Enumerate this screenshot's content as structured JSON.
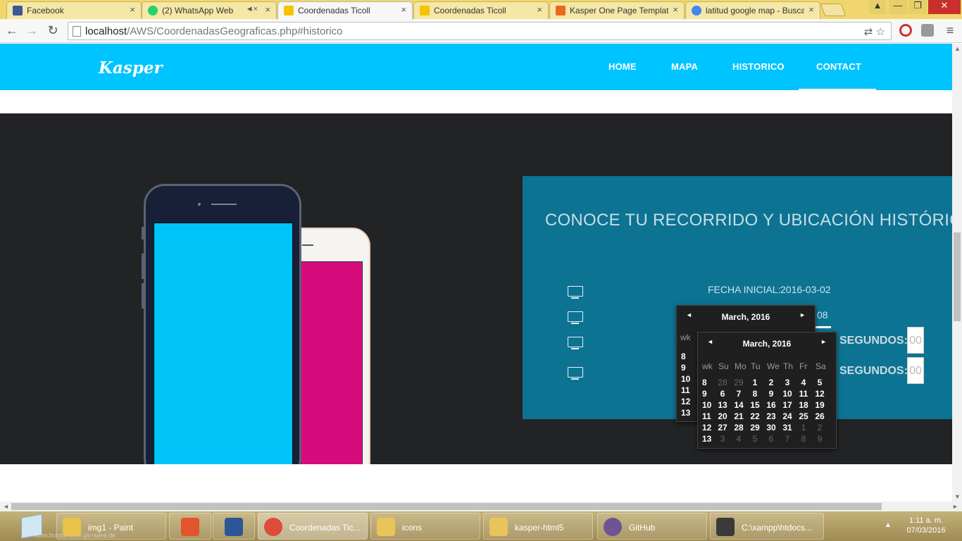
{
  "browser": {
    "tabs": [
      {
        "label": "Facebook",
        "color": "#3b5998"
      },
      {
        "label": "(2) WhatsApp Web",
        "color": "#25d366"
      },
      {
        "label": "Coordenadas Ticoll",
        "color": "#f5c400"
      },
      {
        "label": "Coordenadas Ticoll",
        "color": "#f5c400"
      },
      {
        "label": "Kasper One Page Template",
        "color": "#e86a1b"
      },
      {
        "label": "latitud google map - Busca",
        "color": "#4285f4"
      }
    ],
    "tab_close_glyph": "×",
    "url_host": "localhost",
    "url_path": "/AWS/CoordenadasGeograficas.php#historico"
  },
  "site": {
    "logo": "Kasper",
    "nav": [
      "HOME",
      "MAPA",
      "HISTORICO",
      "CONTACT"
    ],
    "accent_color": "#00c4ff"
  },
  "form": {
    "title": "CONOCE TU RECORRIDO Y UBICACIÓN HISTÓRICA",
    "fecha_inicial_label": "FECHA INICIAL:",
    "fecha_inicial_value": "2016-03-02",
    "fecha_final_partial": "08",
    "segundos_label": "SEGUNDOS:",
    "segundos_placeholder": "00"
  },
  "datepicker_back": {
    "title": "March, 2016",
    "wk_label": "wk",
    "weeks": [
      "8",
      "9",
      "10",
      "11",
      "12",
      "13"
    ]
  },
  "datepicker_front": {
    "title": "March, 2016",
    "headers": [
      "wk",
      "Su",
      "Mo",
      "Tu",
      "We",
      "Th",
      "Fr",
      "Sa"
    ],
    "rows": [
      {
        "wk": "8",
        "days": [
          {
            "d": "28",
            "m": true
          },
          {
            "d": "29",
            "m": true
          },
          {
            "d": "1"
          },
          {
            "d": "2"
          },
          {
            "d": "3"
          },
          {
            "d": "4"
          },
          {
            "d": "5"
          }
        ]
      },
      {
        "wk": "9",
        "days": [
          {
            "d": "6"
          },
          {
            "d": "7"
          },
          {
            "d": "8"
          },
          {
            "d": "9"
          },
          {
            "d": "10"
          },
          {
            "d": "11"
          },
          {
            "d": "12"
          }
        ]
      },
      {
        "wk": "10",
        "days": [
          {
            "d": "13"
          },
          {
            "d": "14"
          },
          {
            "d": "15"
          },
          {
            "d": "16"
          },
          {
            "d": "17"
          },
          {
            "d": "18"
          },
          {
            "d": "19"
          }
        ]
      },
      {
        "wk": "11",
        "days": [
          {
            "d": "20"
          },
          {
            "d": "21"
          },
          {
            "d": "22"
          },
          {
            "d": "23"
          },
          {
            "d": "24"
          },
          {
            "d": "25"
          },
          {
            "d": "26"
          }
        ]
      },
      {
        "wk": "12",
        "days": [
          {
            "d": "27"
          },
          {
            "d": "28"
          },
          {
            "d": "29"
          },
          {
            "d": "30"
          },
          {
            "d": "31"
          },
          {
            "d": "1",
            "m": true
          },
          {
            "d": "2",
            "m": true
          }
        ]
      },
      {
        "wk": "13",
        "days": [
          {
            "d": "3",
            "m": true
          },
          {
            "d": "4",
            "m": true
          },
          {
            "d": "5",
            "m": true
          },
          {
            "d": "6",
            "m": true
          },
          {
            "d": "7",
            "m": true
          },
          {
            "d": "8",
            "m": true
          },
          {
            "d": "9",
            "m": true
          }
        ]
      }
    ]
  },
  "taskbar": {
    "items": [
      {
        "label": "img1 - Paint",
        "color": "#e9c24a"
      },
      {
        "label": "",
        "color": "#e3532c"
      },
      {
        "label": "",
        "color": "#2b5797"
      },
      {
        "label": "Coordenadas Tic...",
        "color": "#dd4b39"
      },
      {
        "label": "icons",
        "color": "#e8c45a"
      },
      {
        "label": "kasper-html5",
        "color": "#e8c45a"
      },
      {
        "label": "GitHub",
        "color": "#6e5494"
      },
      {
        "label": "C:\\xampp\\htdocs...",
        "color": "#3a3a3a"
      }
    ],
    "time": "1:11 a. m.",
    "date": "07/03/2016",
    "watermark": "www.buroundsen.pc-ware.de"
  }
}
